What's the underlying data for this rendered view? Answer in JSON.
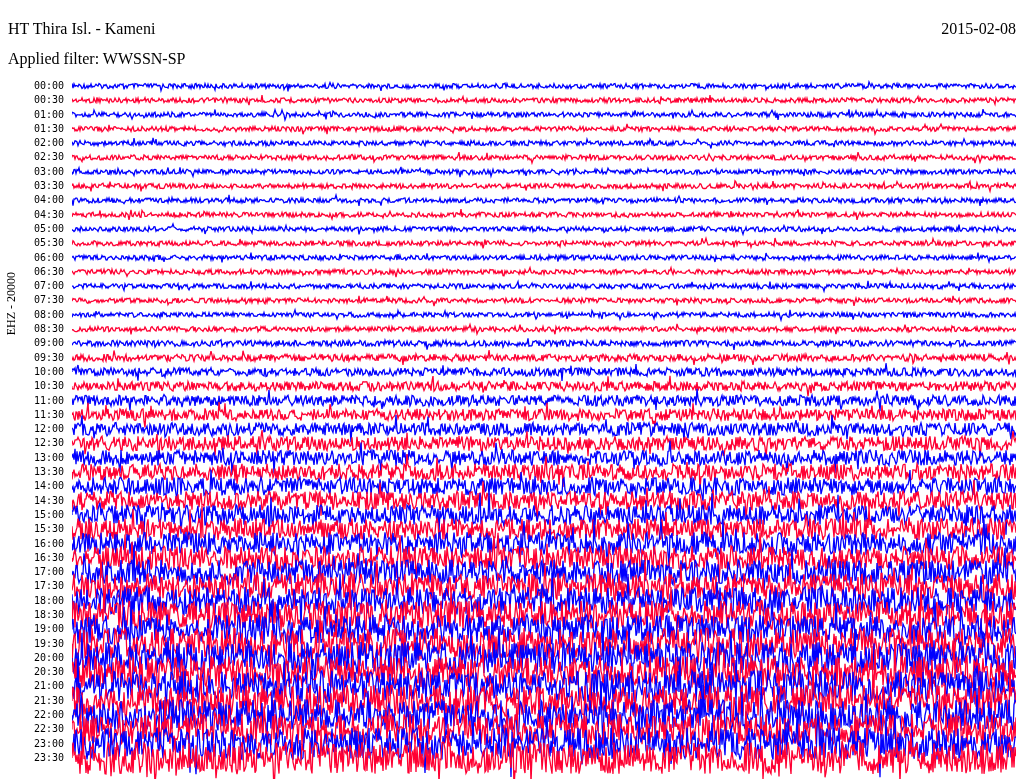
{
  "header": {
    "station": "HT Thira Isl. - Kameni",
    "date": "2015-02-08",
    "filter": "Applied filter: WWSSN-SP"
  },
  "helicorder": {
    "axis_label": "EHZ - 20000",
    "rows": [
      {
        "time": "00:00",
        "color": "#0000ff"
      },
      {
        "time": "00:30",
        "color": "#ff0033"
      },
      {
        "time": "01:00",
        "color": "#0000ff"
      },
      {
        "time": "01:30",
        "color": "#ff0033"
      },
      {
        "time": "02:00",
        "color": "#0000ff"
      },
      {
        "time": "02:30",
        "color": "#ff0033"
      },
      {
        "time": "03:00",
        "color": "#0000ff"
      },
      {
        "time": "03:30",
        "color": "#ff0033"
      },
      {
        "time": "04:00",
        "color": "#0000ff"
      },
      {
        "time": "04:30",
        "color": "#ff0033"
      },
      {
        "time": "05:00",
        "color": "#0000ff"
      },
      {
        "time": "05:30",
        "color": "#ff0033"
      },
      {
        "time": "06:00",
        "color": "#0000ff"
      },
      {
        "time": "06:30",
        "color": "#ff0033"
      },
      {
        "time": "07:00",
        "color": "#0000ff"
      },
      {
        "time": "07:30",
        "color": "#ff0033"
      },
      {
        "time": "08:00",
        "color": "#0000ff"
      },
      {
        "time": "08:30",
        "color": "#ff0033"
      },
      {
        "time": "09:00",
        "color": "#0000ff"
      },
      {
        "time": "09:30",
        "color": "#ff0033"
      },
      {
        "time": "10:00",
        "color": "#0000ff"
      },
      {
        "time": "10:30",
        "color": "#ff0033"
      },
      {
        "time": "11:00",
        "color": "#0000ff"
      },
      {
        "time": "11:30",
        "color": "#ff0033"
      },
      {
        "time": "12:00",
        "color": "#0000ff"
      },
      {
        "time": "12:30",
        "color": "#ff0033"
      },
      {
        "time": "13:00",
        "color": "#0000ff"
      },
      {
        "time": "13:30",
        "color": "#ff0033"
      },
      {
        "time": "14:00",
        "color": "#0000ff"
      },
      {
        "time": "14:30",
        "color": "#ff0033"
      },
      {
        "time": "15:00",
        "color": "#0000ff"
      },
      {
        "time": "15:30",
        "color": "#ff0033"
      },
      {
        "time": "16:00",
        "color": "#0000ff"
      },
      {
        "time": "16:30",
        "color": "#ff0033"
      },
      {
        "time": "17:00",
        "color": "#0000ff"
      },
      {
        "time": "17:30",
        "color": "#ff0033"
      },
      {
        "time": "18:00",
        "color": "#0000ff"
      },
      {
        "time": "18:30",
        "color": "#ff0033"
      },
      {
        "time": "19:00",
        "color": "#0000ff"
      },
      {
        "time": "19:30",
        "color": "#ff0033"
      },
      {
        "time": "20:00",
        "color": "#0000ff"
      },
      {
        "time": "20:30",
        "color": "#ff0033"
      },
      {
        "time": "21:00",
        "color": "#0000ff"
      },
      {
        "time": "21:30",
        "color": "#ff0033"
      },
      {
        "time": "22:00",
        "color": "#0000ff"
      },
      {
        "time": "22:30",
        "color": "#ff0033"
      },
      {
        "time": "23:00",
        "color": "#0000ff"
      },
      {
        "time": "23:30",
        "color": "#ff0033"
      }
    ]
  }
}
